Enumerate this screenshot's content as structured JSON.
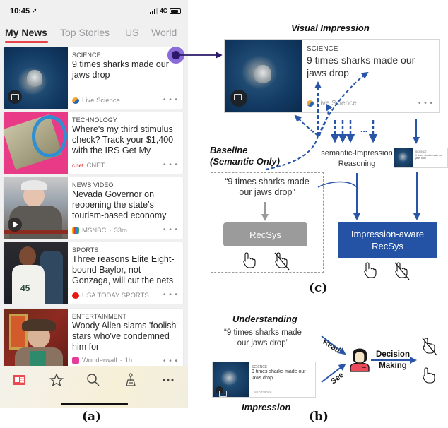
{
  "phone": {
    "status": {
      "time": "10:45",
      "location_icon": "location-arrow-icon",
      "network": "4G"
    },
    "tabs": [
      {
        "label": "My News",
        "active": true
      },
      {
        "label": "Top Stories",
        "active": false
      },
      {
        "label": "US",
        "active": false
      },
      {
        "label": "World",
        "active": false
      }
    ],
    "cards": [
      {
        "category": "SCIENCE",
        "headline": "9 times sharks made our jaws drop",
        "source": "Live Science",
        "time": "",
        "thumb": "shark-photo",
        "badge": "image-gallery-icon"
      },
      {
        "category": "TECHNOLOGY",
        "headline": "Where's my third stimulus check? Track your $1,400 with the IRS Get My",
        "source": "CNET",
        "time": "",
        "thumb": "money-magnifier-photo",
        "badge": ""
      },
      {
        "category": "NEWS VIDEO",
        "headline": "Nevada Governor on reopening the state’s tourism-based economy",
        "source": "MSNBC",
        "time": "33m",
        "thumb": "governor-video-still",
        "badge": "play-icon"
      },
      {
        "category": "SPORTS",
        "headline": "Three reasons Elite Eight-bound Baylor, not Gonzaga, will cut the nets",
        "source": "USA TODAY SPORTS",
        "time": "",
        "thumb": "basketball-player-photo",
        "badge": ""
      },
      {
        "category": "ENTERTAINMENT",
        "headline": "Woody Allen slams 'foolish' stars who've condemned him for",
        "source": "Wonderwall",
        "time": "1h",
        "thumb": "man-in-hat-photo",
        "badge": ""
      }
    ],
    "more_label": "• • •",
    "separator": "·",
    "bottom_nav": [
      "news-icon",
      "star-icon",
      "search-icon",
      "channel-icon",
      "more-icon"
    ],
    "accent": "#e8424a"
  },
  "captions": {
    "a": "(a)",
    "b": "(b)",
    "c": "(c)"
  },
  "diagram_c": {
    "visual_impression_title": "Visual Impression",
    "impression_card": {
      "category": "SCIENCE",
      "headline": "9 times sharks made our jaws drop",
      "source": "Live Science"
    },
    "reasoning_label_1": "semantic-Impression",
    "reasoning_label_2": "Reasoning",
    "ellipsis": "...",
    "baseline_title_1": "Baseline",
    "baseline_title_2": "(Semantic Only)",
    "quote_1": "“9 times sharks made",
    "quote_2": "our jaws drop”",
    "baseline_recsys": "RecSys",
    "impression_recsys_1": "Impression-aware",
    "impression_recsys_2": "RecSys",
    "baseline_color": "#9b9b9b",
    "impression_color": "#2452a5",
    "arrow_color": "#2855a8"
  },
  "diagram_b": {
    "understanding_title": "Understanding",
    "quote_1": "“9 times sharks made",
    "quote_2": "our jaws drop”",
    "impression_title": "Impression",
    "read_label": "Read",
    "see_label": "See",
    "decision_1": "Decision",
    "decision_2": "Making",
    "user_icon": "user-avatar-icon",
    "impression_card": {
      "category": "SCIENCE",
      "headline": "9 times sharks made our jaws drop",
      "source": "Live Science"
    }
  },
  "marker_color": "#8b6bd8"
}
